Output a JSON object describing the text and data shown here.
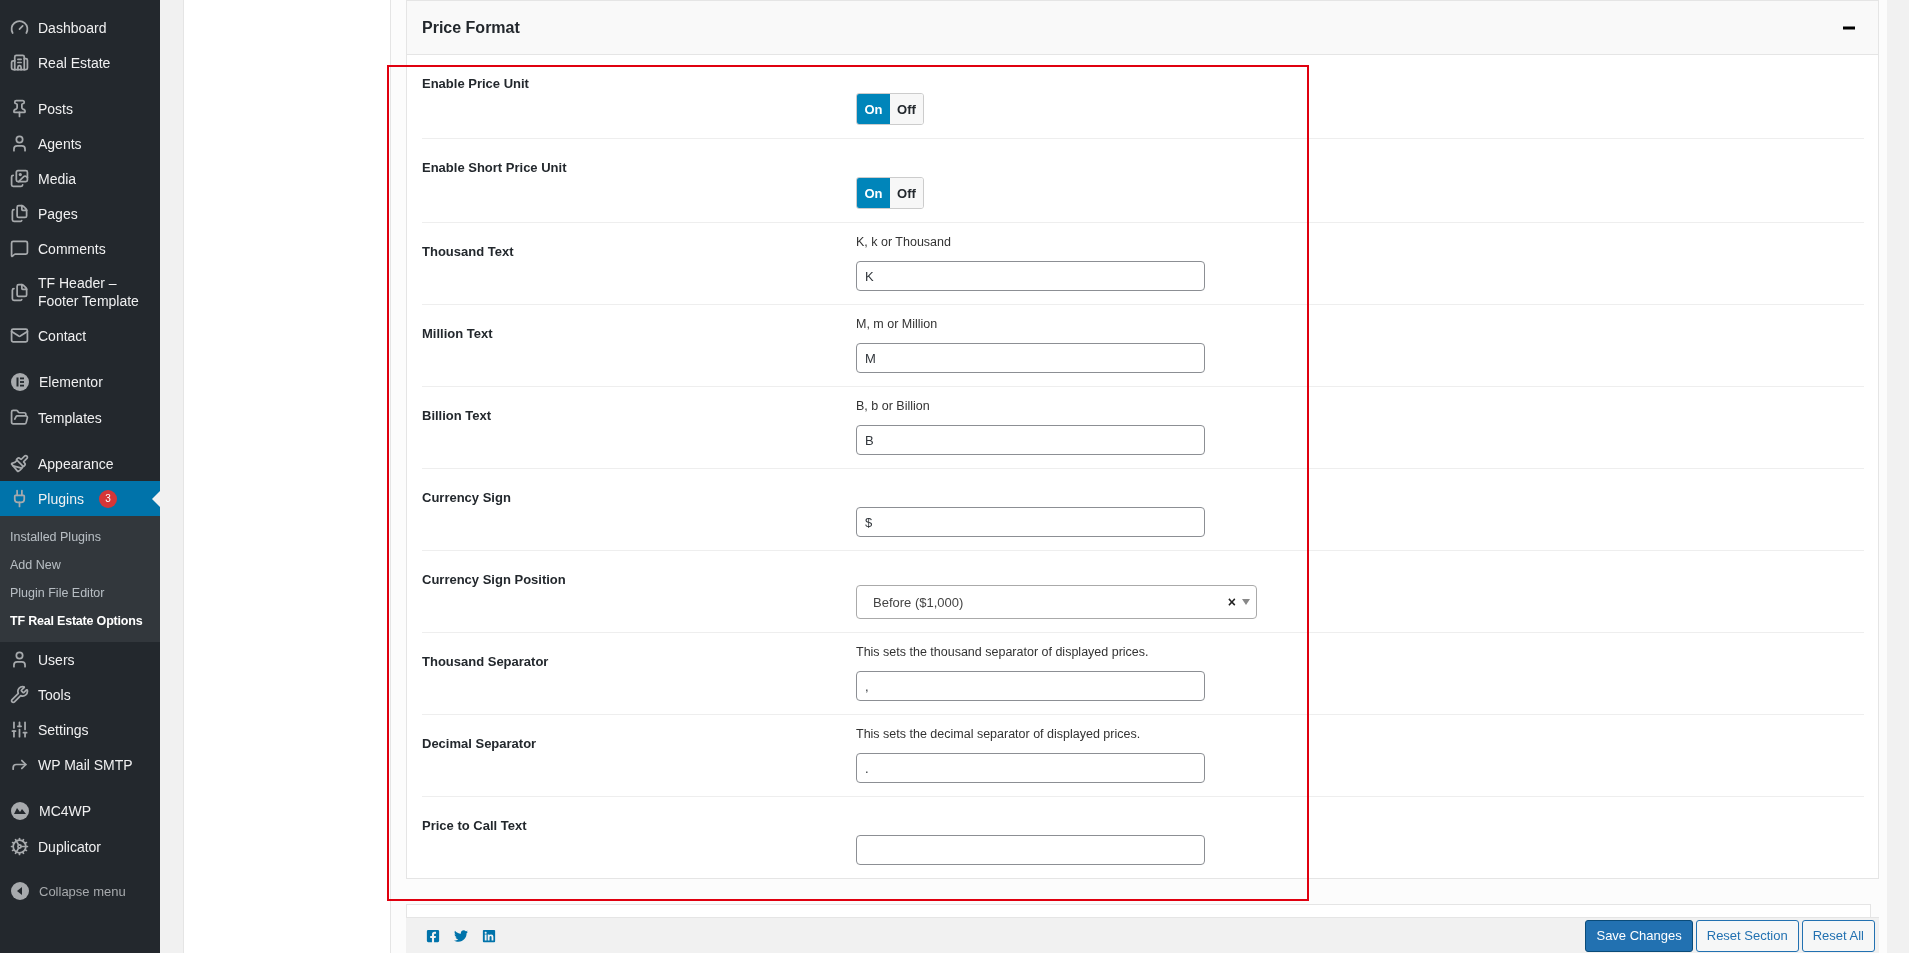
{
  "sidebar": {
    "groups": [
      {
        "items": [
          {
            "label": "Dashboard",
            "selected": false
          },
          {
            "label": "Real Estate",
            "selected": false
          }
        ]
      },
      {
        "items": [
          {
            "label": "Posts",
            "selected": false
          },
          {
            "label": "Agents",
            "selected": false
          },
          {
            "label": "Media",
            "selected": false
          },
          {
            "label": "Pages",
            "selected": false
          },
          {
            "label": "Comments",
            "selected": false
          },
          {
            "label": "TF Header – Footer Template",
            "selected": false
          },
          {
            "label": "Contact",
            "selected": false
          }
        ]
      },
      {
        "items": [
          {
            "label": "Elementor",
            "selected": false
          },
          {
            "label": "Templates",
            "selected": false
          }
        ]
      },
      {
        "items": [
          {
            "label": "Appearance",
            "selected": false
          },
          {
            "label": "Plugins",
            "selected": true,
            "badge": "3",
            "children": [
              {
                "label": "Installed Plugins",
                "selected": false
              },
              {
                "label": "Add New",
                "selected": false
              },
              {
                "label": "Plugin File Editor",
                "selected": false
              },
              {
                "label": "TF Real Estate Options",
                "selected": true
              }
            ]
          },
          {
            "label": "Users",
            "selected": false
          },
          {
            "label": "Tools",
            "selected": false
          },
          {
            "label": "Settings",
            "selected": false
          },
          {
            "label": "WP Mail SMTP",
            "selected": false
          }
        ]
      },
      {
        "items": [
          {
            "label": "MC4WP",
            "selected": false
          },
          {
            "label": "Duplicator",
            "selected": false
          }
        ]
      }
    ],
    "collapse": {
      "label": "Collapse menu"
    }
  },
  "section": {
    "title": "Price Format",
    "expanded": true,
    "fields": [
      {
        "kind": "toggle",
        "label": "Enable Price Unit",
        "on": true,
        "on_label": "On",
        "off_label": "Off"
      },
      {
        "kind": "toggle",
        "label": "Enable Short Price Unit",
        "on": true,
        "on_label": "On",
        "off_label": "Off"
      },
      {
        "kind": "text",
        "label": "Thousand Text",
        "hint": "K, k or Thousand",
        "value": "K"
      },
      {
        "kind": "text",
        "label": "Million Text",
        "hint": "M, m or Million",
        "value": "M"
      },
      {
        "kind": "text",
        "label": "Billion Text",
        "hint": "B, b or Billion",
        "value": "B"
      },
      {
        "kind": "text",
        "label": "Currency Sign",
        "value": "$"
      },
      {
        "kind": "select",
        "label": "Currency Sign Position",
        "value": "Before ($1,000)",
        "clear": "×"
      },
      {
        "kind": "text",
        "label": "Thousand Separator",
        "hint": "This sets the thousand separator of displayed prices.",
        "value": ","
      },
      {
        "kind": "text",
        "label": "Decimal Separator",
        "hint": "This sets the decimal separator of displayed prices.",
        "value": "."
      },
      {
        "kind": "text",
        "label": "Price to Call Text"
      }
    ]
  },
  "footer": {
    "buttons": [
      {
        "label": "Save Changes",
        "kind": "primary"
      },
      {
        "label": "Reset Section",
        "kind": "secondary"
      },
      {
        "label": "Reset All",
        "kind": "secondary"
      }
    ]
  }
}
